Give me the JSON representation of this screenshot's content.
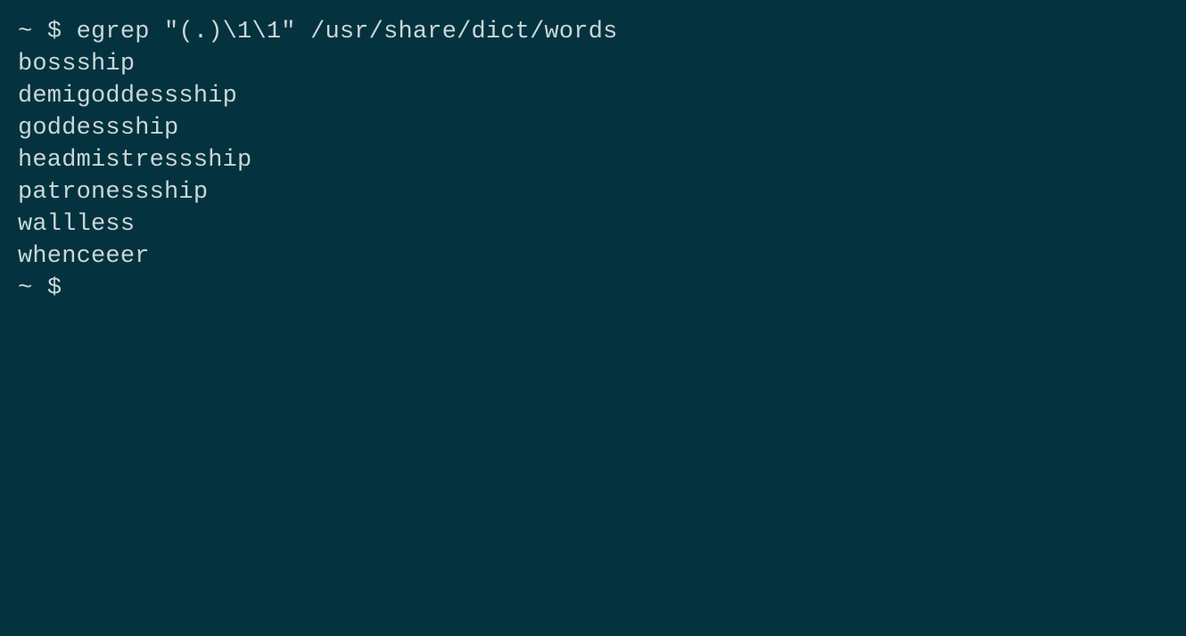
{
  "prompt1": {
    "dir": "~",
    "sym": "$",
    "command": "egrep \"(.)\\1\\1\" /usr/share/dict/words"
  },
  "output": [
    "bossship",
    "demigoddessship",
    "goddessship",
    "headmistressship",
    "patronessship",
    "wallless",
    "whenceeer"
  ],
  "prompt2": {
    "dir": "~",
    "sym": "$",
    "command": ""
  }
}
